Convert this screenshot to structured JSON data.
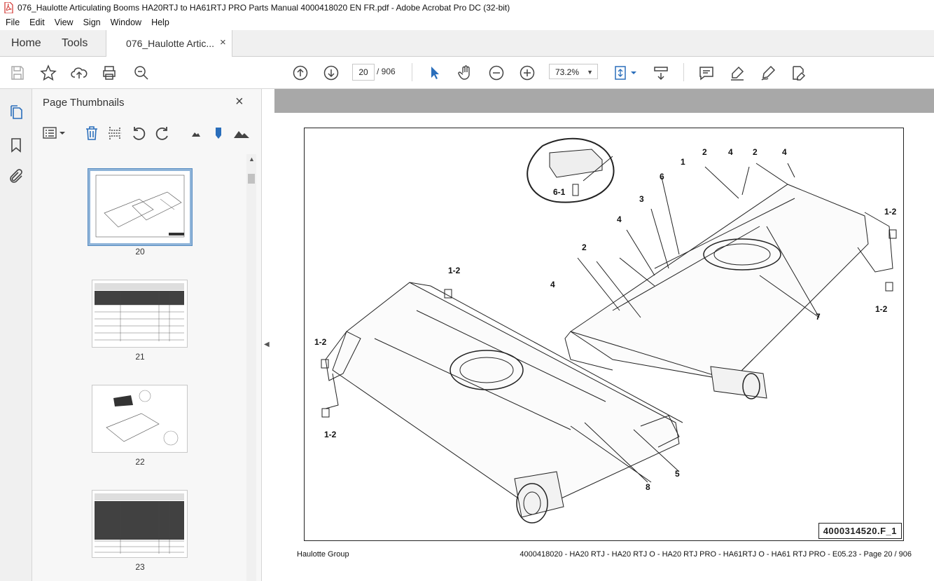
{
  "window": {
    "title": "076_Haulotte Articulating Booms HA20RTJ to HA61RTJ PRO Parts Manual 4000418020 EN FR.pdf - Adobe Acrobat Pro DC (32-bit)"
  },
  "menu": {
    "items": [
      "File",
      "Edit",
      "View",
      "Sign",
      "Window",
      "Help"
    ]
  },
  "tabs": {
    "home": "Home",
    "tools": "Tools",
    "doc": "076_Haulotte Artic...",
    "close": "×"
  },
  "toolbar": {
    "page_current": "20",
    "page_total": "/ 906",
    "zoom": "73.2%"
  },
  "thumbnails": {
    "title": "Page Thumbnails",
    "close": "×",
    "pages": [
      "20",
      "21",
      "22",
      "23"
    ]
  },
  "document": {
    "drawing_id": "4000314520.F_1",
    "callouts": [
      "2",
      "4",
      "2",
      "4",
      "1",
      "6",
      "6-1",
      "3",
      "4",
      "1-2",
      "2",
      "4",
      "1-2",
      "1-2",
      "7",
      "1-2",
      "1-2",
      "5",
      "8"
    ],
    "footer_left": "Haulotte Group",
    "footer_right": "4000418020 - HA20 RTJ - HA20 RTJ O - HA20 RTJ PRO - HA61RTJ O - HA61 RTJ PRO - E05.23 - Page 20 / 906"
  },
  "colors": {
    "pdf_red": "#d0312d",
    "accent_blue": "#2a6ebb",
    "doc_bg": "#a8a8a8"
  }
}
